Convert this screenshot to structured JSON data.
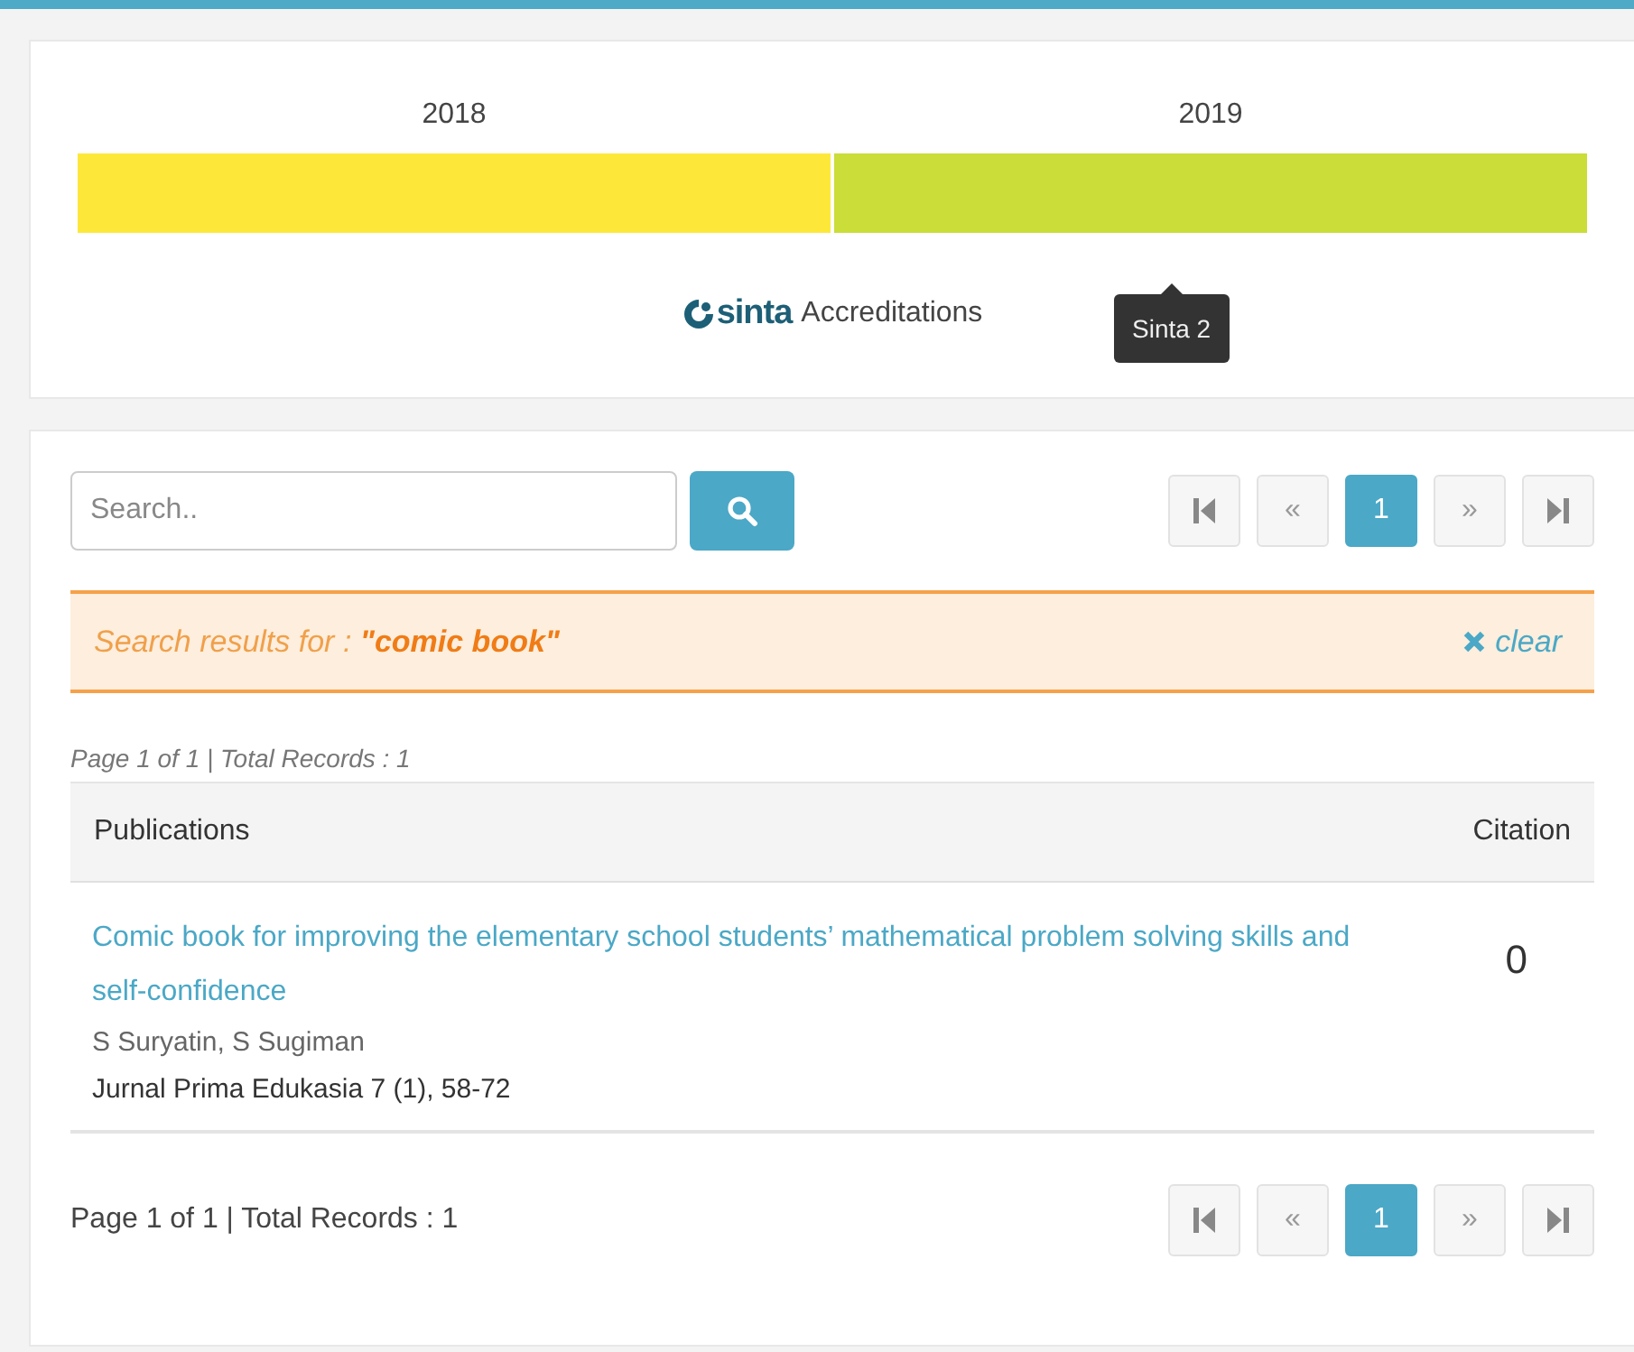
{
  "accreditation": {
    "years": [
      {
        "label": "2018",
        "color": "#fde83a"
      },
      {
        "label": "2019",
        "color": "#cadd38",
        "tooltip": "Sinta 2"
      }
    ],
    "logo": "sinta",
    "caption": "Accreditations"
  },
  "search": {
    "placeholder": "Search.."
  },
  "top_pager": [
    {
      "kind": "first"
    },
    {
      "kind": "prev",
      "label": "«"
    },
    {
      "kind": "page",
      "label": "1",
      "selected": true
    },
    {
      "kind": "next",
      "label": "»"
    },
    {
      "kind": "last"
    }
  ],
  "alert": {
    "prefix": "Search results for : ",
    "query": "\"comic book\"",
    "clear": "clear"
  },
  "info_top": "Page 1 of 1 | Total Records : 1",
  "table": {
    "columns": [
      "Publications",
      "Citation"
    ],
    "rows": [
      {
        "title": "Comic book for improving the elementary school students’ mathematical problem solving skills and self-confidence",
        "authors": "S Suryatin, S Sugiman",
        "journal": "Jurnal Prima Edukasia 7 (1), 58-72",
        "citation": "0"
      }
    ]
  },
  "info_bottom": "Page 1 of 1 | Total Records : 1",
  "bottom_pager": [
    {
      "kind": "first"
    },
    {
      "kind": "prev",
      "label": "«"
    },
    {
      "kind": "page",
      "label": "1",
      "selected": true
    },
    {
      "kind": "next",
      "label": "»"
    },
    {
      "kind": "last"
    }
  ]
}
